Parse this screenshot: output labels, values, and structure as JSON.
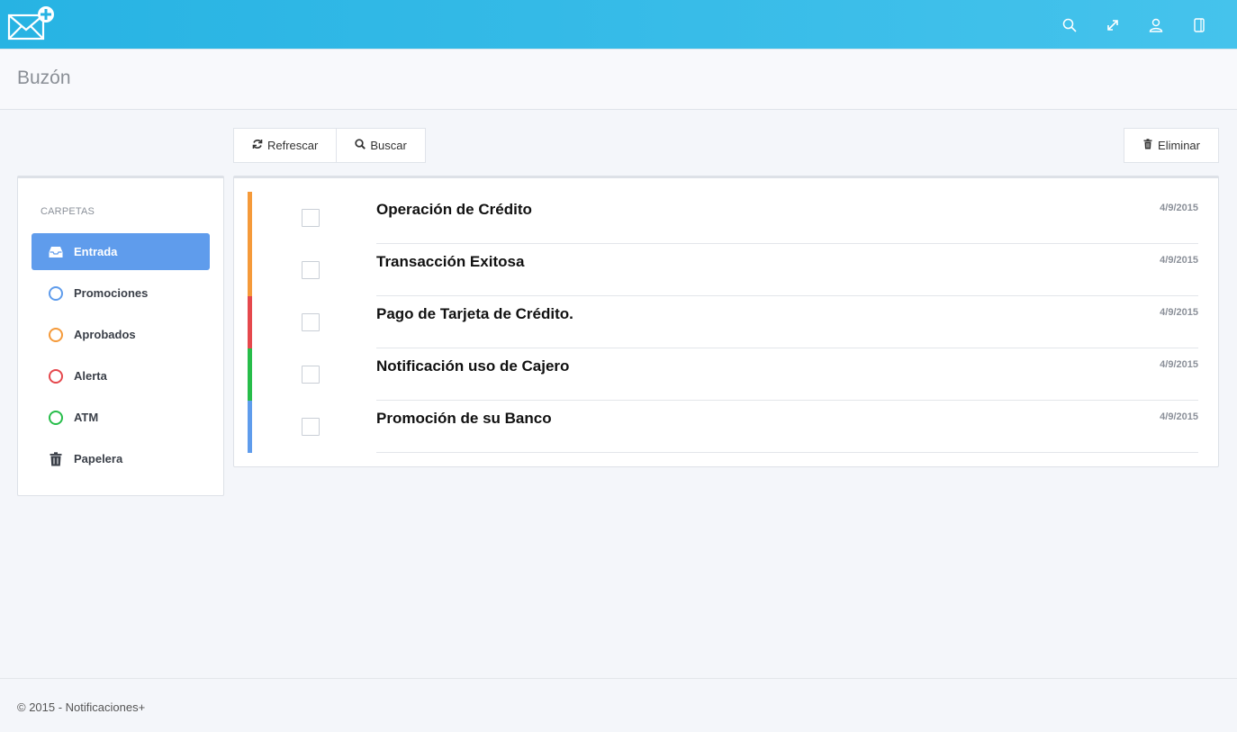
{
  "app": {
    "logo_icon": "mail-plus-icon",
    "brand_color_start": "#27b3e3",
    "brand_color_end": "#45c3ec"
  },
  "topbar": {
    "icons": [
      {
        "name": "search-icon"
      },
      {
        "name": "expand-icon"
      },
      {
        "name": "user-icon"
      },
      {
        "name": "tablet-icon"
      }
    ]
  },
  "header": {
    "title": "Buzón"
  },
  "toolbar": {
    "refresh_label": "Refrescar",
    "search_label": "Buscar",
    "delete_label": "Eliminar"
  },
  "sidebar": {
    "heading": "CARPETAS",
    "items": [
      {
        "label": "Entrada",
        "icon": "inbox-icon",
        "active": true
      },
      {
        "label": "Promociones",
        "icon": "circle-icon",
        "color": "#5f9cec"
      },
      {
        "label": "Aprobados",
        "icon": "circle-icon",
        "color": "#f59a3a"
      },
      {
        "label": "Alerta",
        "icon": "circle-icon",
        "color": "#e5484d"
      },
      {
        "label": "ATM",
        "icon": "circle-icon",
        "color": "#27bd4a"
      },
      {
        "label": "Papelera",
        "icon": "trash-icon"
      }
    ]
  },
  "mail": {
    "rows": [
      {
        "subject": "Operación de Crédito",
        "date": "4/9/2015",
        "color": "#f59a3a"
      },
      {
        "subject": "Transacción Exitosa",
        "date": "4/9/2015",
        "color": "#f59a3a"
      },
      {
        "subject": "Pago de Tarjeta de Crédito.",
        "date": "4/9/2015",
        "color": "#e5484d"
      },
      {
        "subject": "Notificación uso de Cajero",
        "date": "4/9/2015",
        "color": "#27bd4a"
      },
      {
        "subject": "Promoción de su Banco",
        "date": "4/9/2015",
        "color": "#5f9cec"
      }
    ]
  },
  "footer": {
    "text": "© 2015 - Notificaciones+"
  }
}
